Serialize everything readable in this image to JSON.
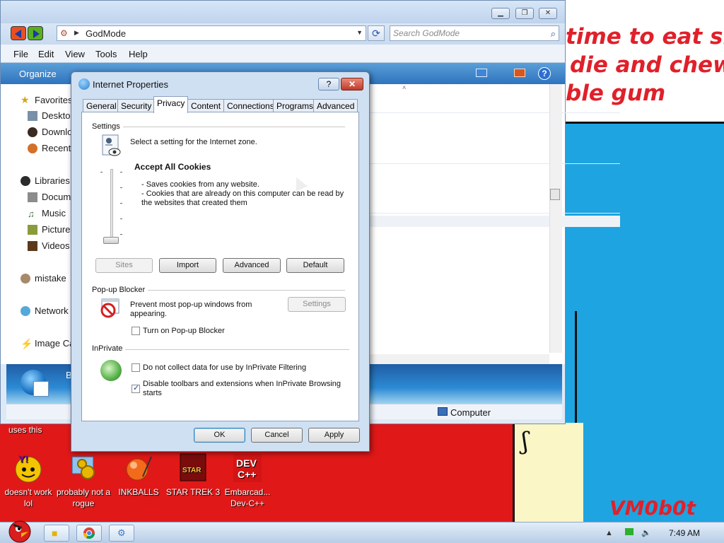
{
  "wallpaper": {
    "lines": [
      "time to eat shit",
      "die and chew",
      "ble gum"
    ],
    "signature": "VM0b0t"
  },
  "desktop_icons": [
    {
      "label": "doesn't work lol",
      "icon": "yahoo-icon"
    },
    {
      "label": "probably not a rogue",
      "icon": "gears-monitor-icon"
    },
    {
      "label": "INKBALLS",
      "icon": "inkball-icon"
    },
    {
      "label": "STAR TREK 3",
      "icon": "star-trek-icon"
    },
    {
      "label": "Embarcad... Dev-C++",
      "icon": "devcpp-icon"
    }
  ],
  "desktop_note": "uses this",
  "explorer": {
    "address": "GodMode",
    "search_placeholder": "Search GodMode",
    "menu": [
      "File",
      "Edit",
      "View",
      "Tools",
      "Help"
    ],
    "organize": "Organize",
    "nav_items": [
      {
        "label": "Favorites",
        "icon": "star-icon"
      },
      {
        "label": "Desktop",
        "icon": "desktop-icon"
      },
      {
        "label": "Downloads",
        "icon": "downloads-icon"
      },
      {
        "label": "Recent Places",
        "icon": "recent-icon"
      },
      {
        "label": "Libraries",
        "icon": "libraries-icon"
      },
      {
        "label": "Documents",
        "icon": "documents-icon"
      },
      {
        "label": "Music",
        "icon": "music-icon"
      },
      {
        "label": "Pictures",
        "icon": "pictures-icon"
      },
      {
        "label": "Videos",
        "icon": "videos-icon"
      },
      {
        "label": "mistake",
        "icon": "user-icon"
      },
      {
        "label": "Network",
        "icon": "network-icon"
      },
      {
        "label": "Image Ca",
        "icon": "image-capture-icon"
      }
    ],
    "details_label": "Bl",
    "status": "Computer"
  },
  "dialog": {
    "title": "Internet Properties",
    "help_btn": "?",
    "close_btn": "✕",
    "tabs": [
      "General",
      "Security",
      "Privacy",
      "Content",
      "Connections",
      "Programs",
      "Advanced"
    ],
    "active_tab": "Privacy",
    "settings": {
      "group": "Settings",
      "prompt": "Select a setting for the Internet zone.",
      "level_title": "Accept All Cookies",
      "level_desc_1": "- Saves cookies from any website.",
      "level_desc_2": "- Cookies that are already on this computer can be read by the websites that created them",
      "slider_level": 0,
      "buttons": {
        "sites": "Sites",
        "import": "Import",
        "advanced": "Advanced",
        "default": "Default"
      }
    },
    "popup": {
      "group": "Pop-up Blocker",
      "desc": "Prevent most pop-up windows from appearing.",
      "settings_btn": "Settings",
      "checkbox": "Turn on Pop-up Blocker",
      "checked": false
    },
    "inprivate": {
      "group": "InPrivate",
      "opt1": "Do not collect data for use by InPrivate Filtering",
      "opt1_checked": false,
      "opt2": "Disable toolbars and extensions when InPrivate Browsing starts",
      "opt2_checked": true
    },
    "footer": {
      "ok": "OK",
      "cancel": "Cancel",
      "apply": "Apply"
    }
  },
  "taskbar": {
    "clock": "7:49 AM"
  }
}
